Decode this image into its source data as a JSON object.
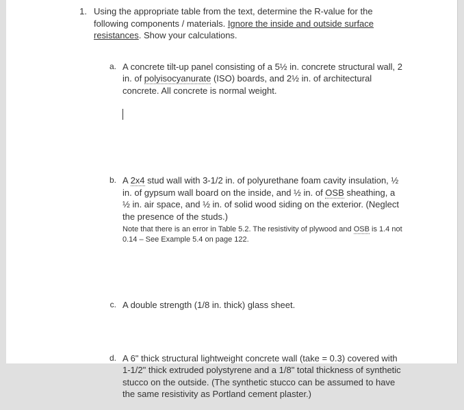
{
  "question": {
    "number": "1.",
    "intro_1": "Using the appropriate table from the text, determine the R-value for the following components / materials. ",
    "intro_underline": "Ignore the inside and outside surface resistances",
    "intro_2": ". Show your calculations."
  },
  "items": {
    "a": {
      "label": "a.",
      "part1": "A concrete tilt-up panel consisting of a 5½ in. concrete structural wall, 2 in. of ",
      "term": "polyisocyanurate",
      "part2": " (ISO) boards, and 2½ in. of architectural concrete. All concrete is normal weight."
    },
    "b": {
      "label": "b.",
      "part1": "A ",
      "term1": "2x4",
      "part2": " stud wall with 3-1/2 in. of polyurethane foam cavity insulation, ½ in. of gypsum wall board on the inside, and ½ in. of ",
      "term2": "OSB",
      "part3": " sheathing, a ½ in. air space, and ½ in. of solid wood siding on the exterior. (Neglect the presence of the studs.)",
      "note1": "Note that there is an error in Table 5.2. The resistivity of plywood and ",
      "note_term": "OSB",
      "note2": " is 1.4 not 0.14 – See Example 5.4 on page 122."
    },
    "c": {
      "label": "c.",
      "text": "A double strength (1/8 in. thick) glass sheet."
    },
    "d": {
      "label": "d.",
      "part1": "A 6\" thick structural lightweight concrete wall (take ",
      "italic": "",
      "part2": "   = 0.3) covered with 1-1/2\" thick extruded polystyrene and a 1/8\" total thickness of synthetic stucco on the outside. (The synthetic stucco can be assumed to have the same resistivity as Portland cement plaster.)"
    }
  }
}
